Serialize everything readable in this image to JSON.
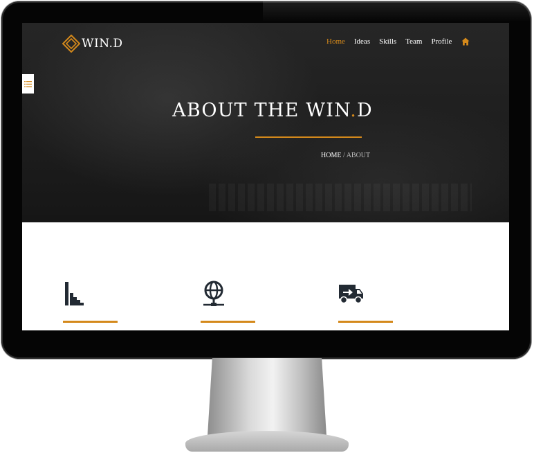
{
  "logo": {
    "text": "WIN.D"
  },
  "nav": {
    "items": [
      {
        "label": "Home",
        "active": true
      },
      {
        "label": "Ideas",
        "active": false
      },
      {
        "label": "Skills",
        "active": false
      },
      {
        "label": "Team",
        "active": false
      },
      {
        "label": "Profile",
        "active": false
      }
    ],
    "home_icon": "home-icon"
  },
  "hero": {
    "title_main": "ABOUT THE WIN",
    "title_dot": ".",
    "title_end": "D"
  },
  "breadcrumb": {
    "home": "HOME",
    "separator": "/",
    "current": "ABOUT"
  },
  "features": [
    {
      "icon": "stairs-icon"
    },
    {
      "icon": "globe-network-icon"
    },
    {
      "icon": "delivery-truck-icon"
    }
  ],
  "colors": {
    "accent": "#d4891b",
    "hero_bg": "#1f1f1f",
    "icon_dark": "#222a33"
  }
}
